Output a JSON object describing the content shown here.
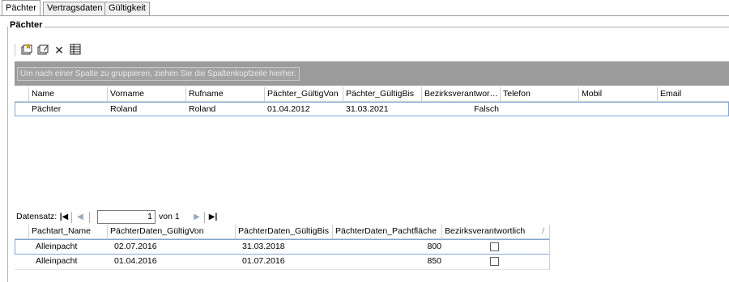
{
  "tabs": [
    "Pächter",
    "Vertragsdaten",
    "Gültigkeit"
  ],
  "group_title": "Pächter",
  "toolbar": {
    "icons": [
      "new-record-icon",
      "edit-record-icon",
      "delete-icon",
      "table-view-icon"
    ],
    "delete_glyph": "✕"
  },
  "group_panel_hint": "Um nach einer Spalte zu gruppieren, ziehen Sie die Spaltenkopfzeile hierher.",
  "main_grid": {
    "columns": [
      "Name",
      "Vorname",
      "Rufname",
      "Pächter_GültigVon",
      "Pächter_GültigBis",
      "Bezirksverantwor…",
      "Telefon",
      "Mobil",
      "Email"
    ],
    "rows": [
      [
        "Pächter",
        "Roland",
        "Roland",
        "01.04.2012",
        "31.03.2021",
        "Falsch",
        "",
        "",
        ""
      ]
    ]
  },
  "navigator": {
    "label": "Datensatz:",
    "first_glyph": "|◀",
    "prev_glyph": "◀",
    "current": "1",
    "of_text": "von 1",
    "next_glyph": "▶",
    "last_glyph": "▶|"
  },
  "detail_grid": {
    "columns": [
      "Pachtart_Name",
      "PächterDaten_GültigVon",
      "PächterDaten_GültigBis",
      "PächterDaten_Pachtfläche",
      "Bezirksverantwortlich"
    ],
    "sort_glyph": "/",
    "rows": [
      [
        "Alleinpacht",
        "02.07.2016",
        "31.03.2018",
        "800",
        false
      ],
      [
        "Alleinpacht",
        "01.04.2016",
        "01.07.2016",
        "850",
        false
      ]
    ]
  }
}
